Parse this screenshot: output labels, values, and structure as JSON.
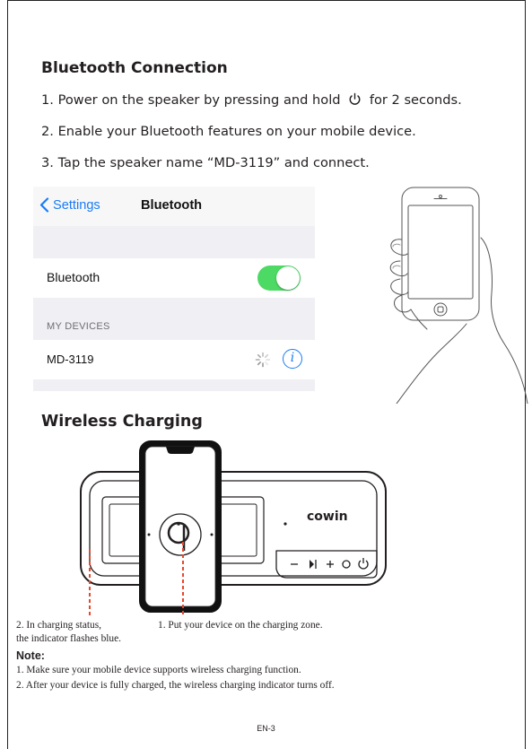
{
  "bluetooth": {
    "title": "Bluetooth Connection",
    "step1_before": "1. Power on the speaker by pressing and hold",
    "step1_after": "for 2 seconds.",
    "step2": "2. Enable your Bluetooth features on your mobile device.",
    "step3": "3. Tap the speaker name “MD-3119” and connect."
  },
  "ios_screen": {
    "back_label": "Settings",
    "nav_title": "Bluetooth",
    "bluetooth_row_label": "Bluetooth",
    "bluetooth_toggle_on": true,
    "section_header": "MY DEVICES",
    "device_name": "MD-3119",
    "info_glyph": "i",
    "colors": {
      "accent": "#1a7cf5",
      "toggle_on": "#4cd964",
      "background": "#efeff4"
    }
  },
  "wireless": {
    "title": "Wireless Charging",
    "speaker_brand": "cowin",
    "caption_left_line1": "2. In charging status,",
    "caption_left_line2": "the indicator flashes blue.",
    "caption_right": "1. Put your device on the charging zone.",
    "indicator_color": "#e8472b"
  },
  "note": {
    "title": "Note:",
    "line1": "1. Make sure your mobile device supports wireless charging function.",
    "line2": "2. After your device is fully charged, the wireless charging indicator turns off."
  },
  "page_number": "EN-3"
}
